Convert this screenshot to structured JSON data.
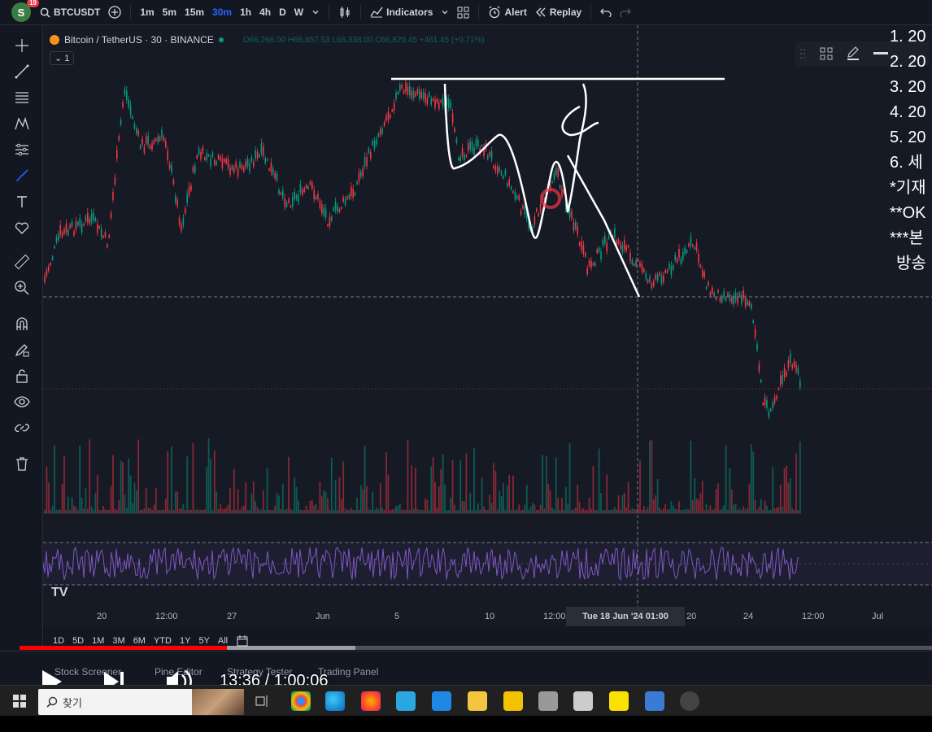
{
  "topbar": {
    "badge": "19",
    "avatar": "S",
    "symbol": "BTCUSDT",
    "intervals": [
      "1m",
      "5m",
      "15m",
      "30m",
      "1h",
      "4h",
      "D",
      "W"
    ],
    "active_interval": "30m",
    "indicators_label": "Indicators",
    "alert_label": "Alert",
    "replay_label": "Replay"
  },
  "legend": {
    "title": "Bitcoin / TetherUS · 30 · BINANCE",
    "ohlc": "O66,266.00 H66,857.53 L66,338.00 C66,829.45 +461.45 (+0.71%)",
    "interval_btn": "1"
  },
  "notes": [
    "1. 20",
    "2. 20",
    "3. 20",
    "4. 20",
    "5. 20",
    "6. 세",
    "*기재",
    "**OK",
    "***본",
    "방송"
  ],
  "axis": {
    "labels": [
      "20",
      "12:00",
      "27",
      "Jun",
      "5",
      "10",
      "12:00",
      "20",
      "24",
      "12:00",
      "Jul"
    ],
    "crosshair": "Tue 18 Jun '24   01:00"
  },
  "ranges": [
    "1D",
    "5D",
    "1M",
    "3M",
    "6M",
    "YTD",
    "1Y",
    "5Y",
    "All"
  ],
  "bottom_tabs": [
    "Stock Screener",
    "Pine Editor",
    "Strategy Tester",
    "Trading Panel"
  ],
  "player": {
    "time": "13:36 / 1:00:06",
    "played_fraction": 0.227,
    "loaded_fraction": 0.368
  },
  "taskbar": {
    "search_placeholder": "찾기"
  },
  "colors": {
    "up": "#089981",
    "down": "#f23645",
    "rsi": "#7e57c2",
    "accent": "#2962ff",
    "progress": "#ff0000"
  }
}
